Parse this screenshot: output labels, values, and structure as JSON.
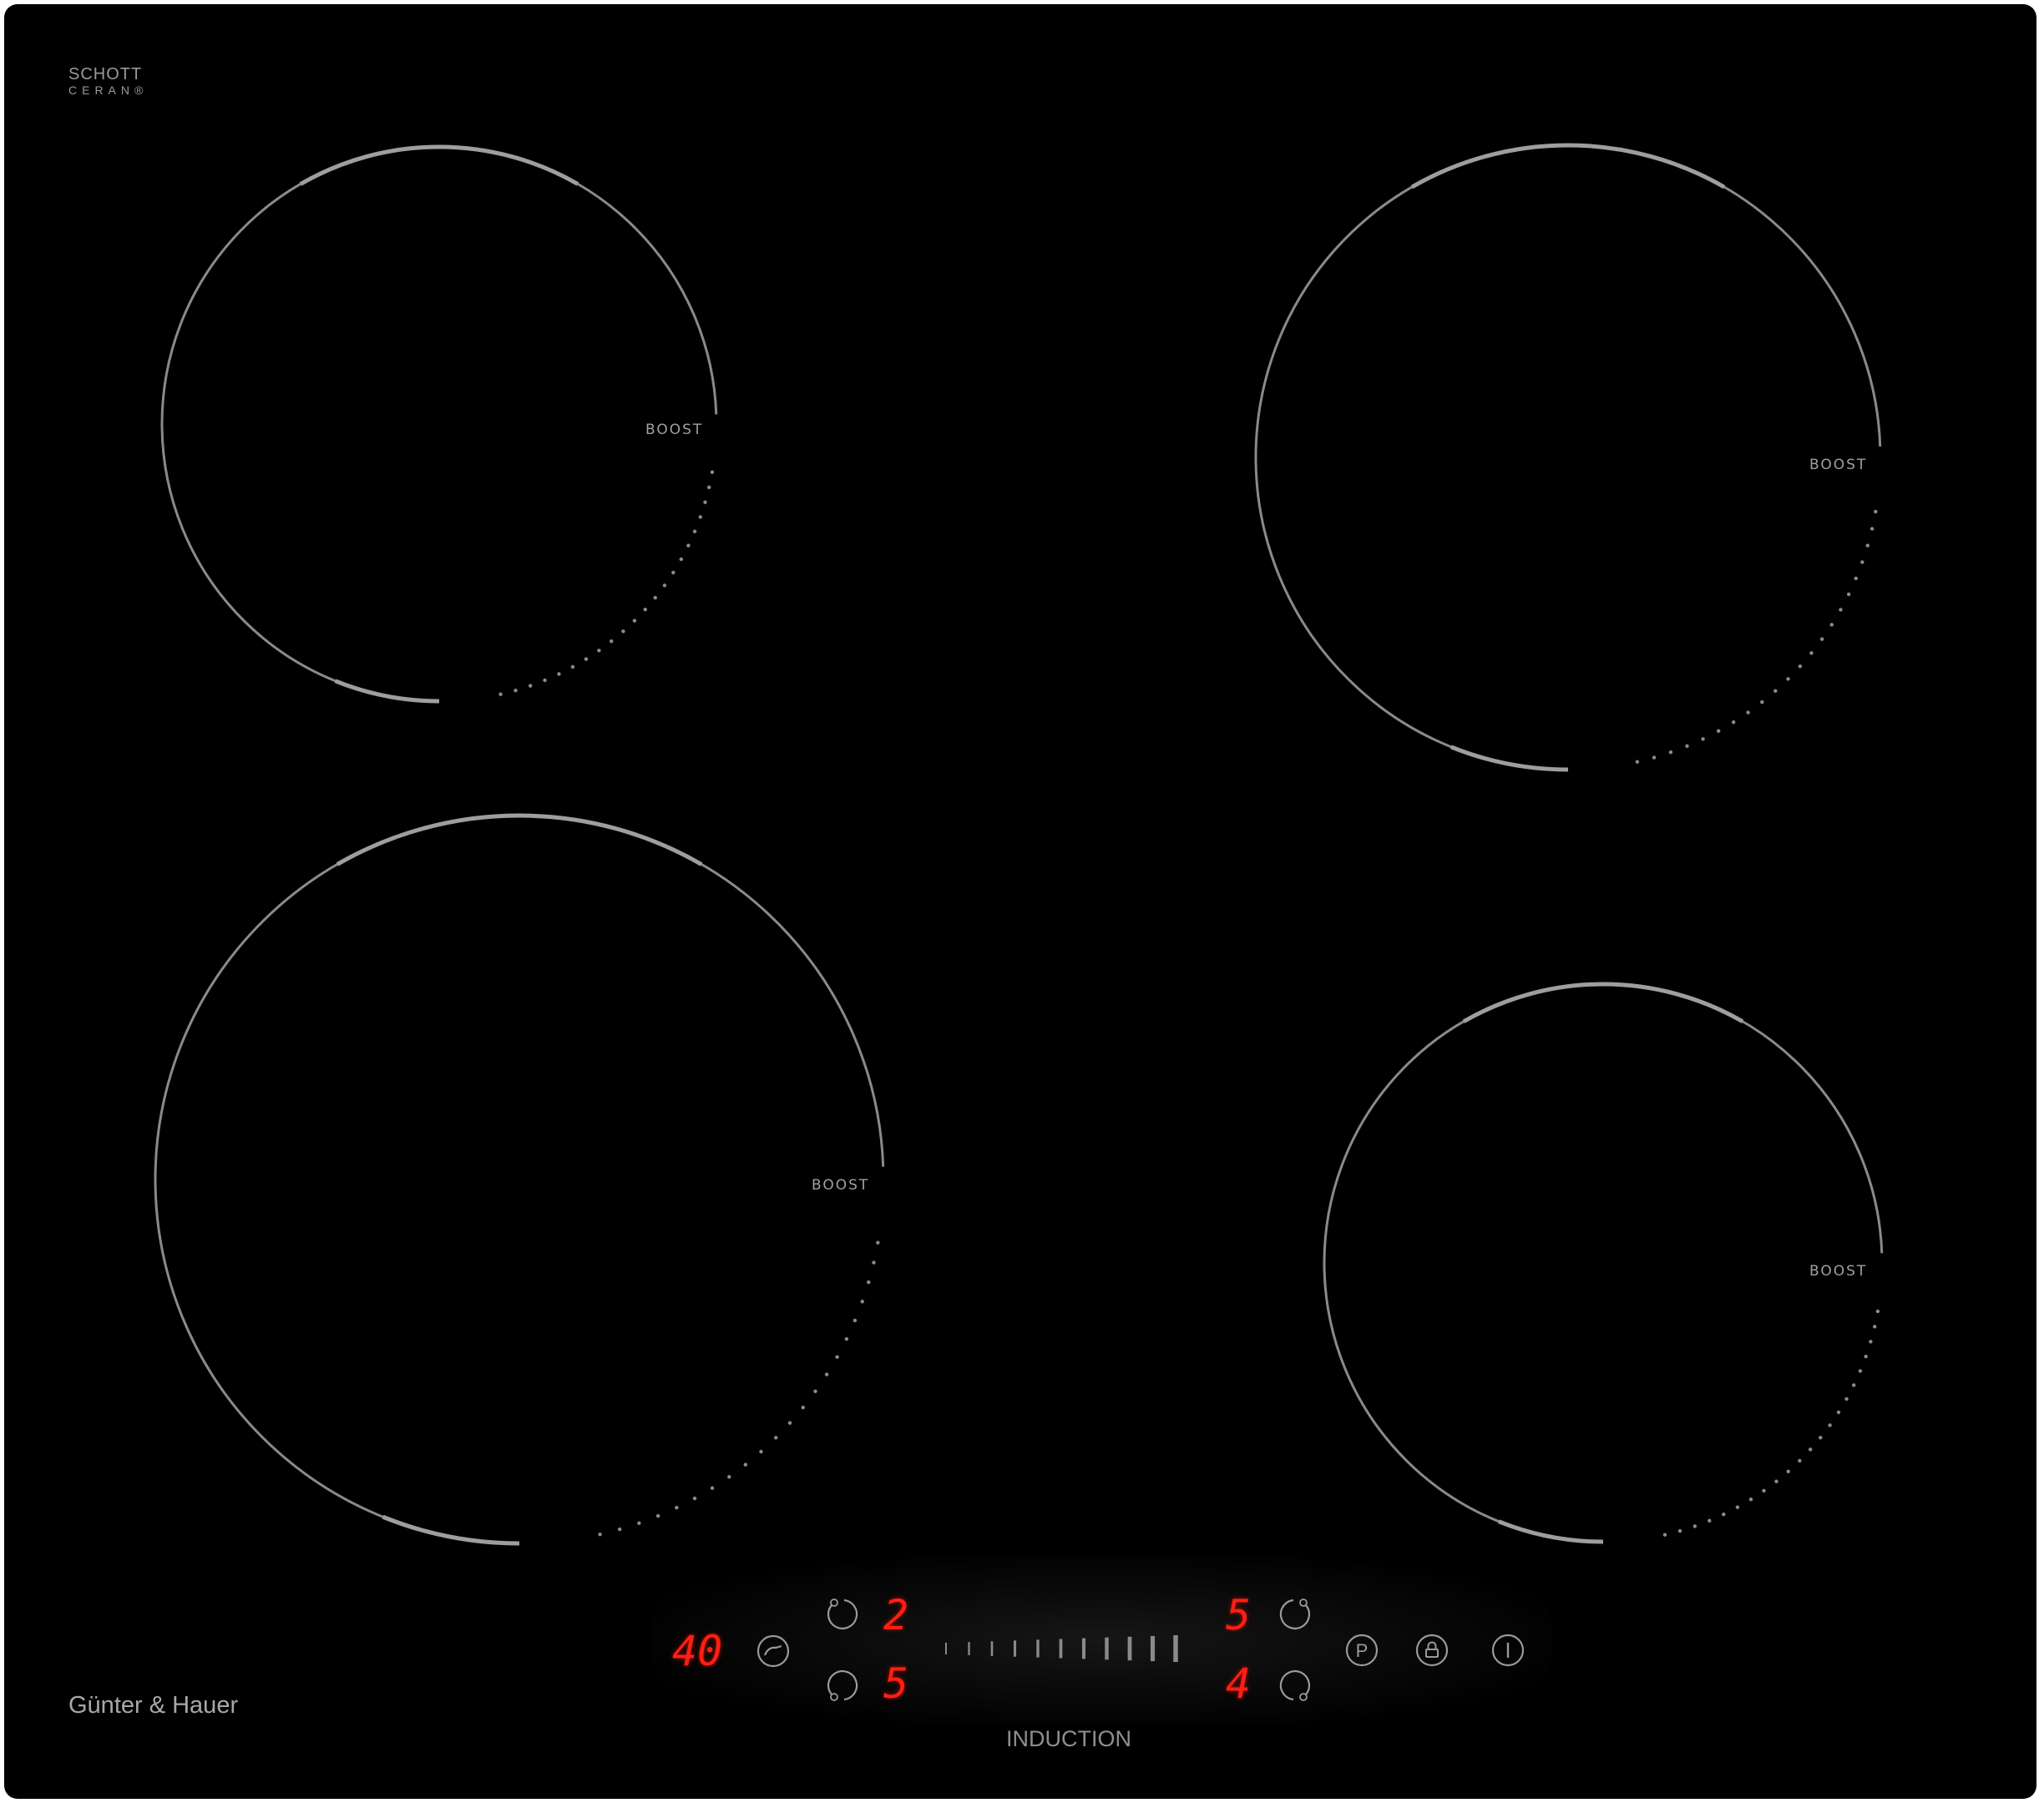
{
  "hob": {
    "glass_logo_line1": "SCHOTT",
    "glass_logo_line2": "CERAN®",
    "brand": "Günter & Hauer",
    "type_label": "INDUCTION"
  },
  "zones": [
    {
      "position": "top-left",
      "boost_label": "BOOST"
    },
    {
      "position": "top-right",
      "boost_label": "BOOST"
    },
    {
      "position": "bottom-left",
      "boost_label": "BOOST"
    },
    {
      "position": "bottom-right",
      "boost_label": "BOOST"
    }
  ],
  "controls": {
    "timer_display": "40",
    "zone_levels": {
      "top_left": "2",
      "bottom_left": "5",
      "top_right": "5",
      "bottom_right": "4"
    },
    "slider_segments": 11,
    "icons": [
      "timer-icon",
      "zone-top-left-icon",
      "zone-bottom-left-icon",
      "zone-top-right-icon",
      "zone-bottom-right-icon",
      "pause-icon",
      "lock-icon",
      "power-icon"
    ],
    "pause_glyph": "P"
  },
  "colors": {
    "glass": "#000000",
    "ring": "#8a8a8a",
    "led": "#ff1e12"
  }
}
